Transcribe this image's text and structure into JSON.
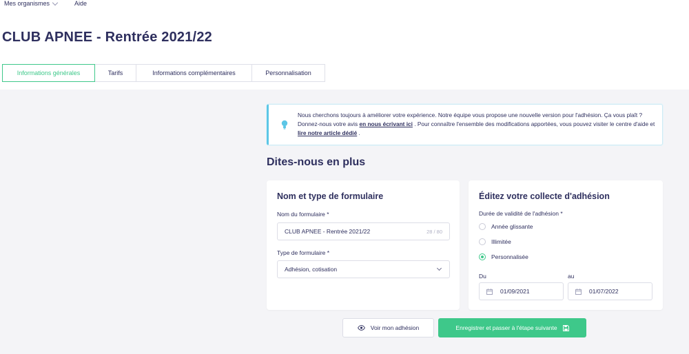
{
  "topnav": {
    "organisations": "Mes organismes",
    "help": "Aide"
  },
  "page": {
    "title": "CLUB APNEE - Rentrée 2021/22"
  },
  "tabs": [
    {
      "label": "Informations générales",
      "active": true
    },
    {
      "label": "Tarifs",
      "active": false
    },
    {
      "label": "Informations complémentaires",
      "active": false
    },
    {
      "label": "Personnalisation",
      "active": false
    }
  ],
  "info": {
    "text1": "Nous cherchons toujours à améliorer votre expérience. Notre équipe vous propose une nouvelle version pour l'adhésion. Ça vous plaît ? Donnez-nous votre avis ",
    "link1": "en nous écrivant ici",
    "text2": " . Pour connaître l'ensemble des modifications apportées, vous pouvez visiter le centre d'aide et ",
    "link2": "lire notre article dédié",
    "text3": " ."
  },
  "section": {
    "title": "Dites-nous en plus"
  },
  "form_card": {
    "title": "Nom et type de formulaire",
    "name_label": "Nom du formulaire *",
    "name_value": "CLUB APNEE - Rentrée 2021/22",
    "name_counter": "28 / 80",
    "type_label": "Type de formulaire *",
    "type_value": "Adhésion, cotisation"
  },
  "collect_card": {
    "title": "Éditez votre collecte d'adhésion",
    "validity_label": "Durée de validité de l'adhésion *",
    "options": [
      {
        "label": "Année glissante",
        "checked": false
      },
      {
        "label": "Illimitée",
        "checked": false
      },
      {
        "label": "Personnalisée",
        "checked": true
      }
    ],
    "from_label": "Du",
    "from_value": "01/09/2021",
    "to_label": "au",
    "to_value": "01/07/2022"
  },
  "actions": {
    "preview": "Voir mon adhésion",
    "save_next": "Enregistrer et passer à l'étape suivante"
  },
  "colors": {
    "accent": "#3ec88a",
    "text": "#2e2f5e",
    "info_border": "#5cc6e6"
  },
  "icons": {
    "info": "lightbulb-icon",
    "preview": "eye-icon",
    "save": "floppy-disk-icon",
    "date": "calendar-icon",
    "select": "chevron-down-icon"
  }
}
